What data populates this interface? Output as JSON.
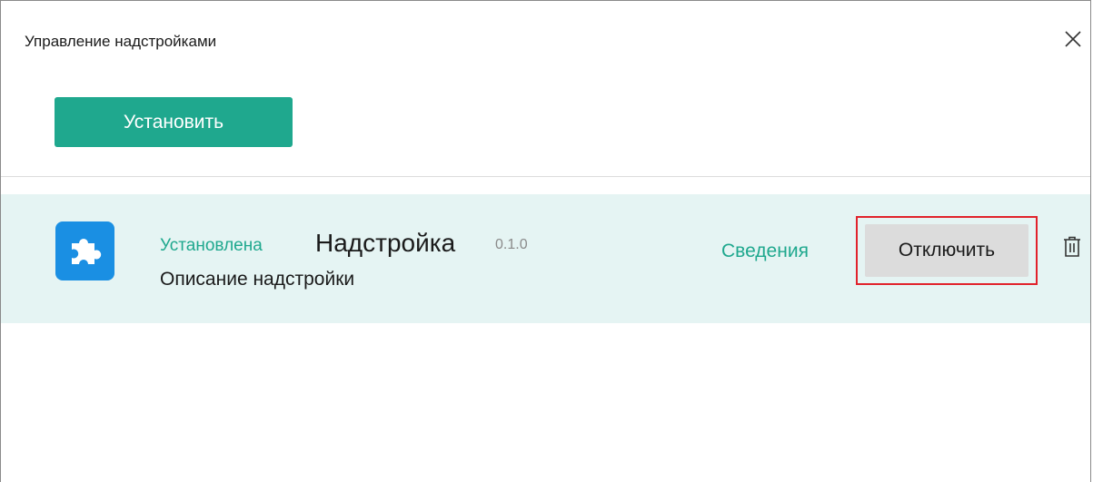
{
  "window": {
    "title": "Управление надстройками",
    "close_icon": "close-icon"
  },
  "toolbar": {
    "install_label": "Установить"
  },
  "addins": [
    {
      "status": "Установлена",
      "name": "Надстройка",
      "version": "0.1.0",
      "description": "Описание надстройки",
      "details_label": "Сведения",
      "disable_label": "Отключить",
      "icon": "puzzle-icon",
      "delete_icon": "trash-icon"
    }
  ],
  "colors": {
    "accent": "#1fa88e",
    "row_background": "#e5f4f3",
    "addin_icon_background": "#1a8fe3",
    "highlight": "#e1222b",
    "disable_button": "#dcdcdc"
  }
}
